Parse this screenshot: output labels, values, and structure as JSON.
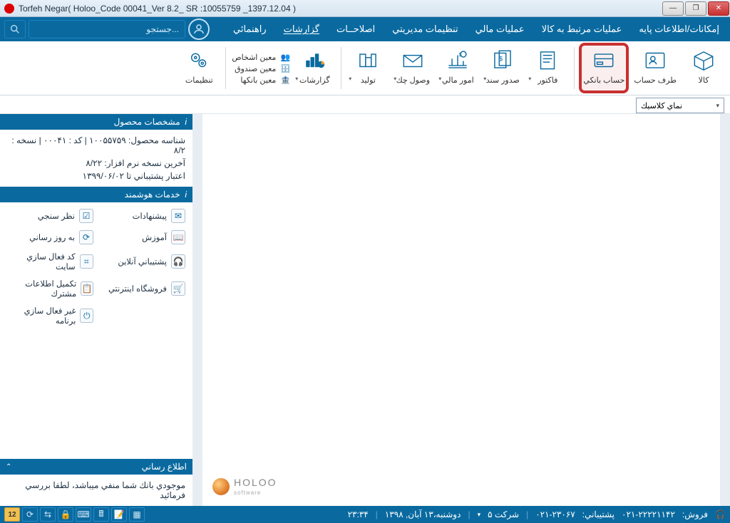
{
  "title": "Torfeh Negar( Holoo_Code 00041_Ver 8.2_ SR :10055759 _1397.12.04 )",
  "menu": {
    "items": [
      "إمكانات/اطلاعات پايه",
      "عمليات مرتبط به كالا",
      "عمليات مالي",
      "تنظيمات مديريتي",
      "اصلاحــات",
      "گزارشات",
      "راهنمائي"
    ]
  },
  "search": {
    "placeholder": "جستجو..."
  },
  "ribbon": {
    "goods": "كالا",
    "account_party": "طرف حساب",
    "bank_account": "حساب بانكي",
    "invoice": "فاكتور",
    "issue_doc": "صدور سند",
    "finance": "امور مالي",
    "cheque": "وصول چك",
    "production": "توليد",
    "reports": "گزارشات",
    "moein_people": "معين اشخاص",
    "moein_fund": "معين صندوق",
    "moein_banks": "معين بانكها",
    "settings": "تنظيمات"
  },
  "view": {
    "selected": "نماي كلاسيك"
  },
  "panels": {
    "product": {
      "title": "مشخصات محصول",
      "line1": "شناسه محصول: ۱۰۰۵۵۷۵۹ | كد : ۰۰۰۴۱ | نسخه : ۸/۲",
      "line2": "آخرين نسخه نرم افزار: ۸/۲۲",
      "line3": "اعتبار پشتيباني تا ۱۳۹۹/۰۶/۰۲"
    },
    "services": {
      "title": "خدمات هوشمند",
      "items": [
        "پيشنهادات",
        "نظر سنجي",
        "آموزش",
        "به روز رساني",
        "پشتيباني آنلاين",
        "كد فعال سازي سايت",
        "فروشگاه اينترنتي",
        "تكميل اطلاعات مشترك",
        "",
        "غير فعال سازي برنامه"
      ]
    },
    "notice": {
      "title": "اطلاع رساني",
      "text": "موجودي بانك شما منفي ميباشد، لطفا بررسي فرمائيد"
    }
  },
  "logo": {
    "name": "HOLOO",
    "sub": "software"
  },
  "status": {
    "sales_label": "فروش:",
    "sales_phone": "۰۲۱-۲۲۲۲۱۱۴۲",
    "support_label": "پشتيباني:",
    "support_phone": "۰۲۱-۲۳۰۶۷",
    "company": "شركت ۵",
    "date": "دوشنبه،۱۳ آبان, ۱۳۹۸",
    "time": "۲۳:۳۴",
    "cal_day": "12"
  }
}
